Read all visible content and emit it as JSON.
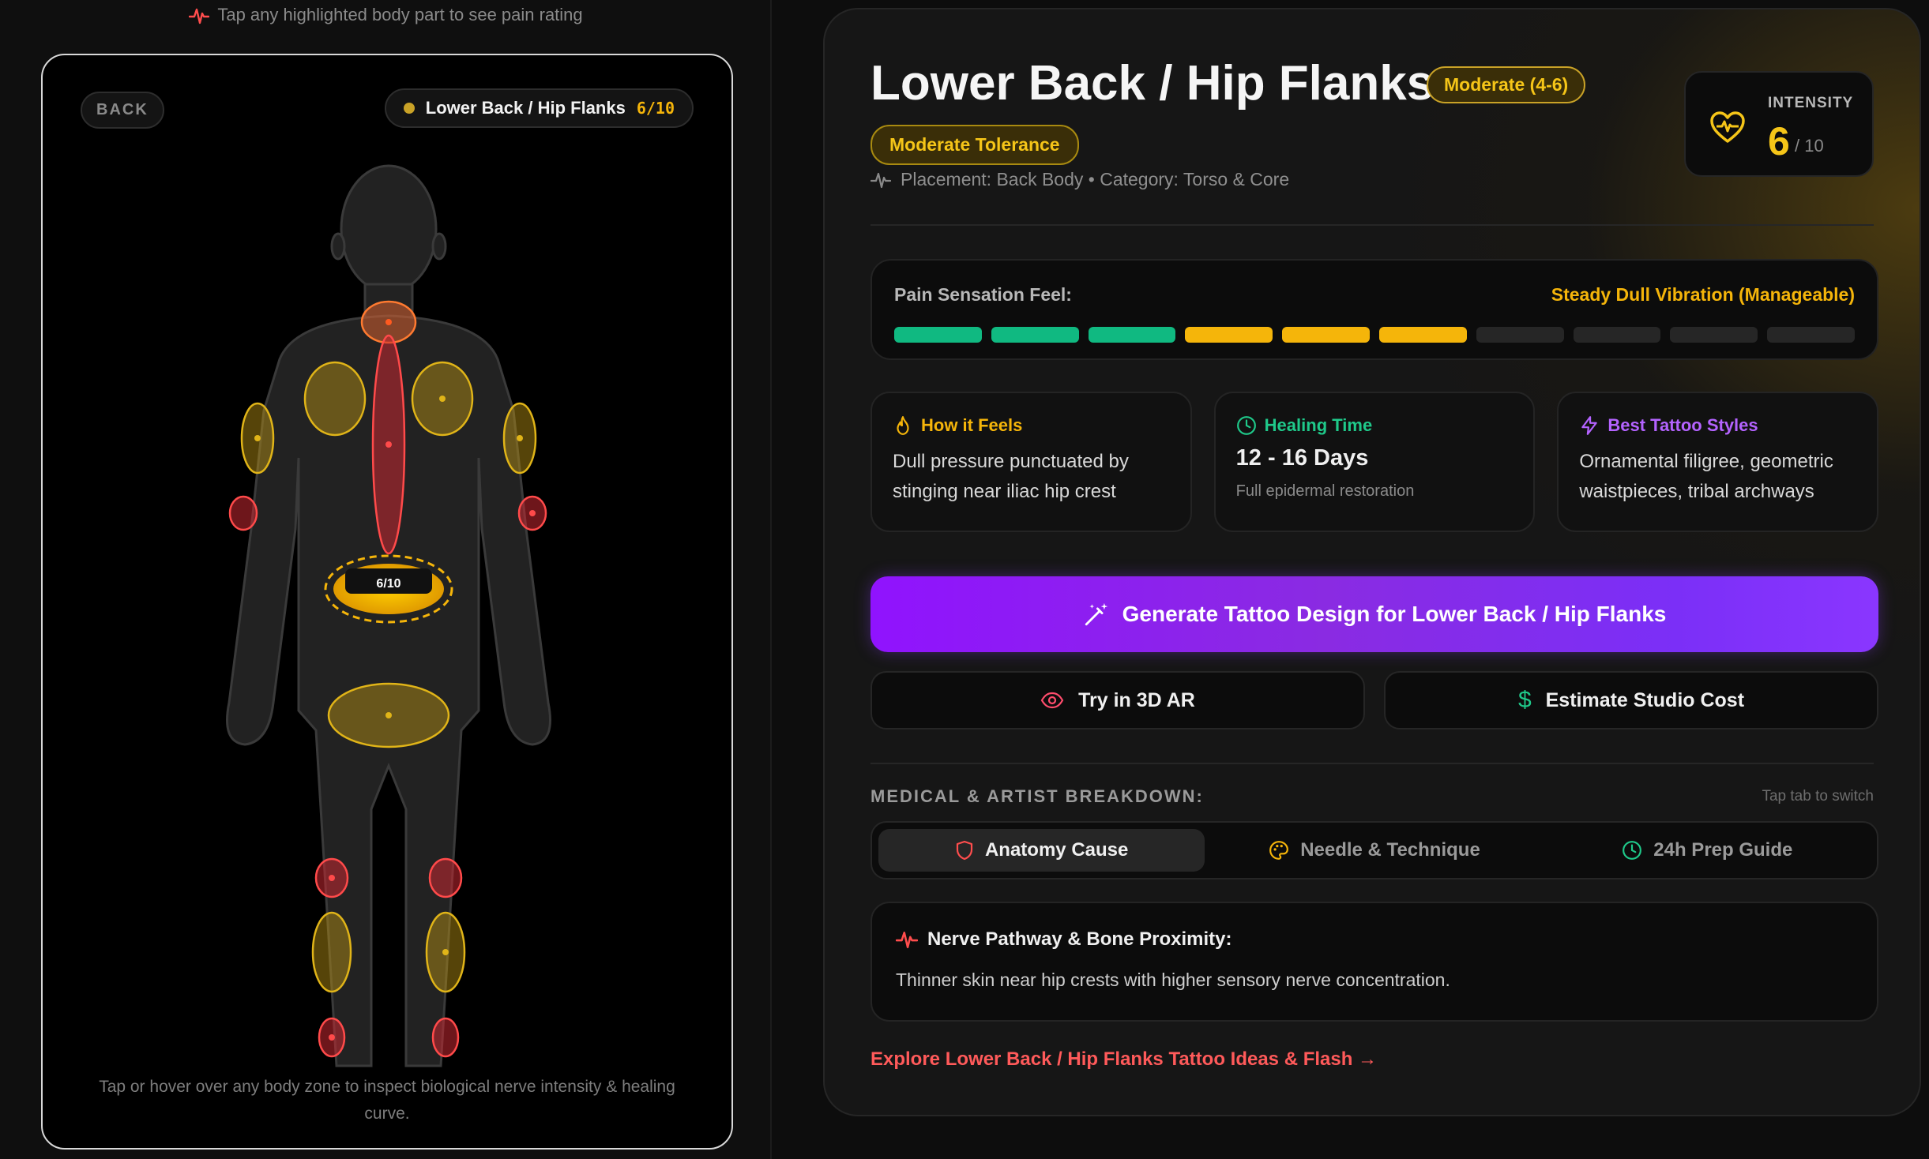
{
  "left_panel": {
    "tap_hint": "Tap any highlighted body part to see pain rating",
    "back_label": "BACK",
    "selected_zone_label": "Lower Back / Hip Flanks",
    "selected_zone_score": "6/10",
    "marker_label": "6/10",
    "footer": "Tap or hover over any body zone to inspect biological nerve intensity & healing curve."
  },
  "detail": {
    "title": "Lower Back / Hip Flanks",
    "range_badge": "Moderate (4-6)",
    "tolerance_badge": "Moderate Tolerance",
    "placement": "Placement: Back Body • Category: Torso & Core",
    "intensity": {
      "label": "INTENSITY",
      "value": "6",
      "out_of": "/ 10"
    },
    "sensation": {
      "label": "Pain Sensation Feel:",
      "feel": "Steady Dull Vibration (Manageable)",
      "level": 6,
      "total": 10
    },
    "cards": [
      {
        "heading": "How it Feels",
        "icon": "flame-icon",
        "color": "#f5b50a",
        "body": "Dull pressure punctuated by stinging near iliac hip crest"
      },
      {
        "heading": "Healing Time",
        "icon": "clock-icon",
        "color": "#1fc98a",
        "value": "12 - 16 Days",
        "sub": "Full epidermal restoration"
      },
      {
        "heading": "Best Tattoo Styles",
        "icon": "bolt-icon",
        "color": "#b463ff",
        "body": "Ornamental filigree, geometric waistpieces, tribal archways"
      }
    ],
    "generate_label": "Generate Tattoo Design for Lower Back / Hip Flanks",
    "ar_label": "Try in 3D AR",
    "cost_label": "Estimate Studio Cost",
    "breakdown_label": "MEDICAL & ARTIST BREAKDOWN:",
    "tap_switch": "Tap tab to switch",
    "tabs": [
      {
        "label": "Anatomy Cause",
        "icon": "shield-icon",
        "active": true
      },
      {
        "label": "Needle & Technique",
        "icon": "palette-icon",
        "active": false
      },
      {
        "label": "24h Prep Guide",
        "icon": "clock-icon",
        "active": false
      }
    ],
    "nerve_heading": "Nerve Pathway & Bone Proximity:",
    "nerve_text": "Thinner skin near hip crests with higher sensory nerve concentration.",
    "explore_label": "Explore Lower Back / Hip Flanks Tattoo Ideas & Flash →"
  },
  "colors": {
    "low": "#10b981",
    "moderate": "#f5b50a",
    "high": "#ef4444",
    "accent_purple": "#8a2be2"
  }
}
